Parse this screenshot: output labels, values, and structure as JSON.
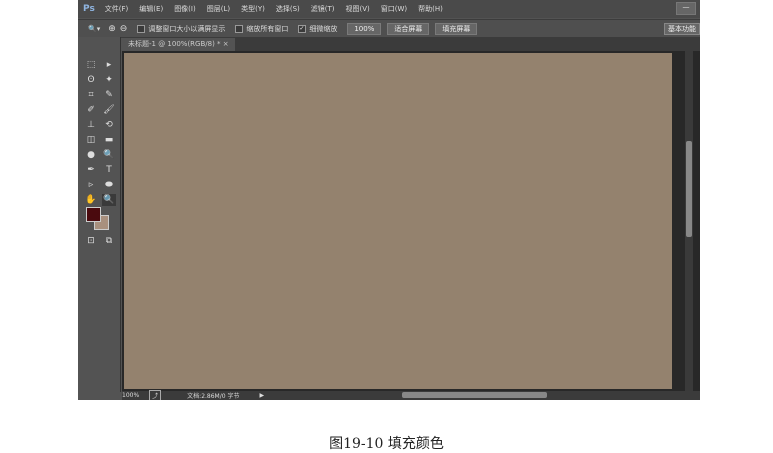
{
  "app": {
    "logo": "Ps"
  },
  "menu": [
    "文件(F)",
    "编辑(E)",
    "图像(I)",
    "图层(L)",
    "类型(Y)",
    "选择(S)",
    "滤镜(T)",
    "视图(V)",
    "窗口(W)",
    "帮助(H)"
  ],
  "window": {
    "minimize": "—"
  },
  "options": {
    "zoom_tool": "🔍▾",
    "zoom_in": "⊕",
    "zoom_out": "⊖",
    "resize_windows": "调整窗口大小以满屏显示",
    "resize_checked": false,
    "zoom_all": "缩放所有窗口",
    "zoom_all_checked": false,
    "scrubby": "细微缩放",
    "scrubby_checked": true,
    "percent": "100%",
    "fit_screen": "适合屏幕",
    "fill_screen": "填充屏幕",
    "workspace": "基本功能"
  },
  "tab": {
    "title": "未标题-1 @ 100%(RGB/8) *",
    "close": "×"
  },
  "tools": [
    "⬚",
    "▸",
    "ʘ",
    "✦",
    "⌗",
    "✎",
    "✐",
    "🖌",
    "⊥",
    "⟲",
    "◫",
    "▬",
    "●",
    "🔍",
    "✒",
    "T",
    "▹",
    "⬬",
    "✋",
    "🔍",
    "⊡",
    "⧉"
  ],
  "colors": {
    "foreground": "#4a0a0e",
    "background": "#a8907e",
    "canvas": "#94826e"
  },
  "status": {
    "zoom": "100%",
    "doc": "文档:2.86M/0 字节",
    "arrow": "▶"
  },
  "caption": "图19-10 填充颜色"
}
